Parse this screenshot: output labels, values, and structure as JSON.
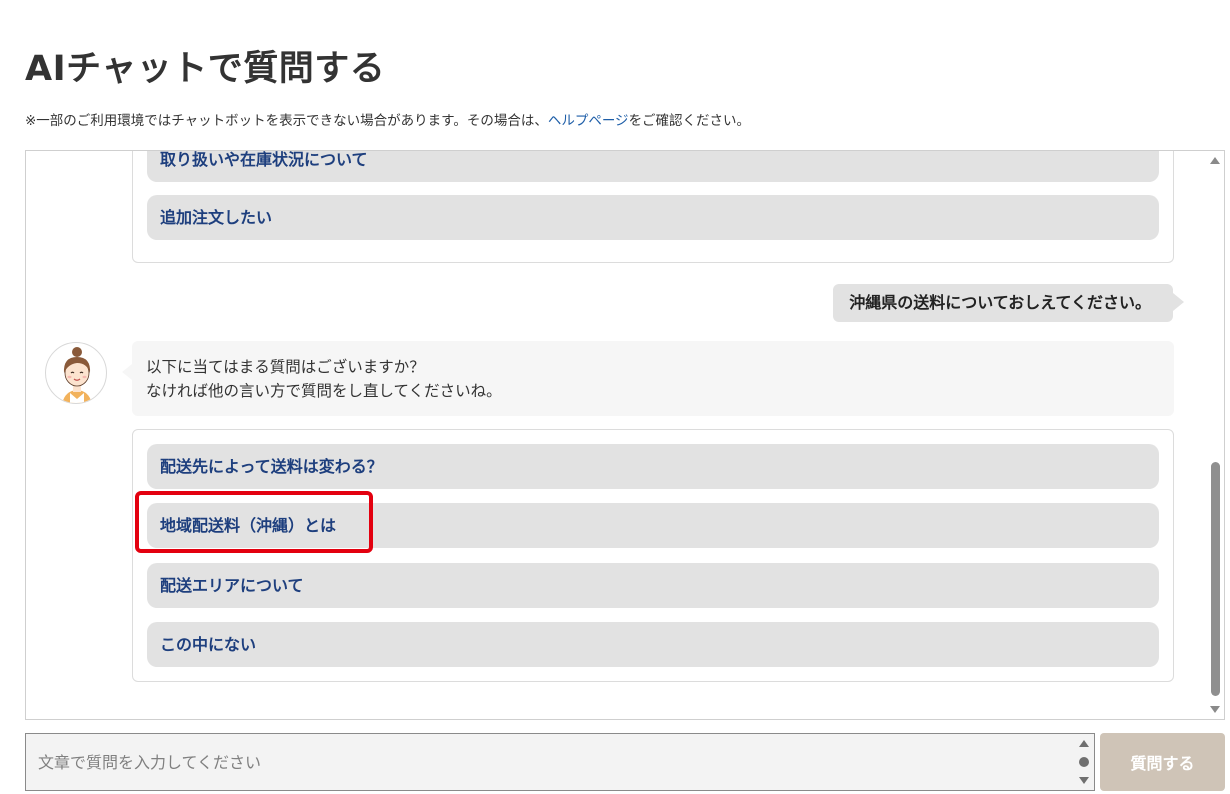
{
  "header": {
    "title": "AIチャットで質問する",
    "notice_before": "※一部のご利用環境ではチャットボットを表示できない場合があります。その場合は、",
    "notice_link": "ヘルプページ",
    "notice_after": "をご確認ください。"
  },
  "chat": {
    "previous_options": [
      {
        "label": "取り扱いや在庫状況について"
      },
      {
        "label": "追加注文したい"
      }
    ],
    "user_message": "沖縄県の送料についておしえてください。",
    "bot_message_line1": "以下に当てはまる質問はございますか？",
    "bot_message_line2": "なければ他の言い方で質問をし直してくださいね。",
    "options": [
      {
        "label": "配送先によって送料は変わる？"
      },
      {
        "label": "地域配送料（沖縄）とは"
      },
      {
        "label": "配送エリアについて"
      },
      {
        "label": "この中にない"
      }
    ]
  },
  "composer": {
    "placeholder": "文章で質問を入力してください",
    "submit_label": "質問する"
  },
  "colors": {
    "option_text": "#1e3f7e",
    "option_bg": "#e2e2e2",
    "link": "#1e5ea8",
    "highlight": "#e3000f",
    "submit_bg": "#cfc4b7"
  }
}
